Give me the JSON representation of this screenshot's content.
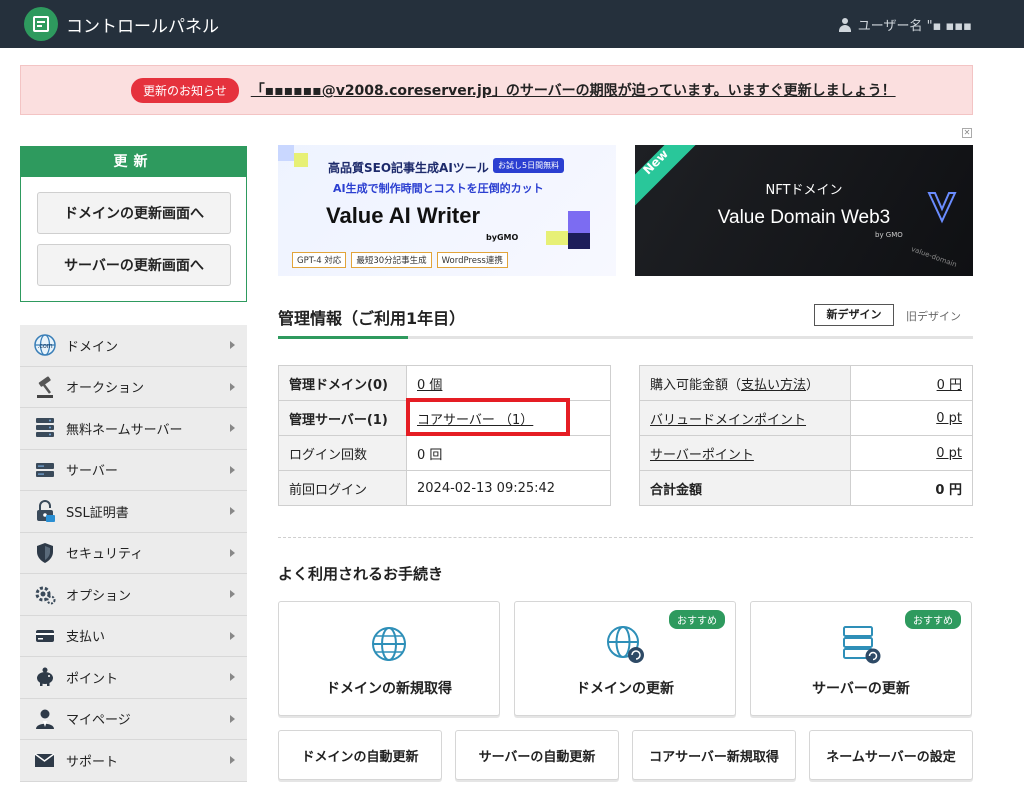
{
  "header": {
    "title": "コントロールパネル",
    "user_label": "ユーザー名 \"▪ ▪▪▪"
  },
  "notice": {
    "badge": "更新のお知らせ",
    "text": "「▪▪▪▪▪▪@v2008.coreserver.jp」のサーバーの期限が迫っています。いますぐ更新しましょう！"
  },
  "update_box": {
    "title": "更新",
    "domain_button": "ドメインの更新画面へ",
    "server_button": "サーバーの更新画面へ"
  },
  "menu": {
    "items": [
      {
        "label": "ドメイン",
        "icon": "globe-icon"
      },
      {
        "label": "オークション",
        "icon": "gavel-icon"
      },
      {
        "label": "無料ネームサーバー",
        "icon": "server-stack-icon"
      },
      {
        "label": "サーバー",
        "icon": "server-icon"
      },
      {
        "label": "SSL証明書",
        "icon": "lock-icon"
      },
      {
        "label": "セキュリティ",
        "icon": "shield-icon"
      },
      {
        "label": "オプション",
        "icon": "gear-icon"
      },
      {
        "label": "支払い",
        "icon": "card-icon"
      },
      {
        "label": "ポイント",
        "icon": "piggy-bank-icon"
      },
      {
        "label": "マイページ",
        "icon": "person-icon"
      },
      {
        "label": "サポート",
        "icon": "mail-icon"
      }
    ]
  },
  "banners": {
    "ai": {
      "line1": "高品質SEO記事生成AIツール",
      "trial": "お試し5日間無料",
      "line2": "AI生成で制作時間とコストを圧倒的カット",
      "brand": "Value AI Writer",
      "by": "byGMO",
      "tags": [
        "GPT-4 対応",
        "最短30分記事生成",
        "WordPress連携"
      ]
    },
    "web3": {
      "new": "New",
      "line1": "NFTドメイン",
      "brand": "Value Domain Web3",
      "by": "by GMO",
      "tag": "value-domain"
    },
    "close": "✕"
  },
  "management": {
    "title": "管理情報（ご利用1年目）",
    "new_design": "新デザイン",
    "old_design": "旧デザイン",
    "left_table": {
      "domain_label": "管理ドメイン(0)",
      "domain_value": "0 個",
      "server_label": "管理サーバー(1)",
      "server_value": "コアサーバー （1）",
      "login_count_label": "ログイン回数",
      "login_count_value": "0 回",
      "last_login_label": "前回ログイン",
      "last_login_value": "2024-02-13 09:25:42"
    },
    "right_table": {
      "purchasable_label": "購入可能金額（",
      "payment_method": "支払い方法",
      "purchasable_label_end": "）",
      "purchasable_value": "0 円",
      "vd_points_label": "バリュードメインポイント",
      "vd_points_value": "0 pt",
      "server_points_label": "サーバーポイント",
      "server_points_value": "0 pt",
      "total_label": "合計金額",
      "total_value": "0 円"
    }
  },
  "procedures": {
    "title": "よく利用されるお手続き",
    "recommended": "おすすめ",
    "cards": [
      {
        "label": "ドメインの新規取得",
        "recommended": false
      },
      {
        "label": "ドメインの更新",
        "recommended": true
      },
      {
        "label": "サーバーの更新",
        "recommended": true
      }
    ],
    "buttons": [
      "ドメインの自動更新",
      "サーバーの自動更新",
      "コアサーバー新規取得",
      "ネームサーバーの設定"
    ]
  }
}
